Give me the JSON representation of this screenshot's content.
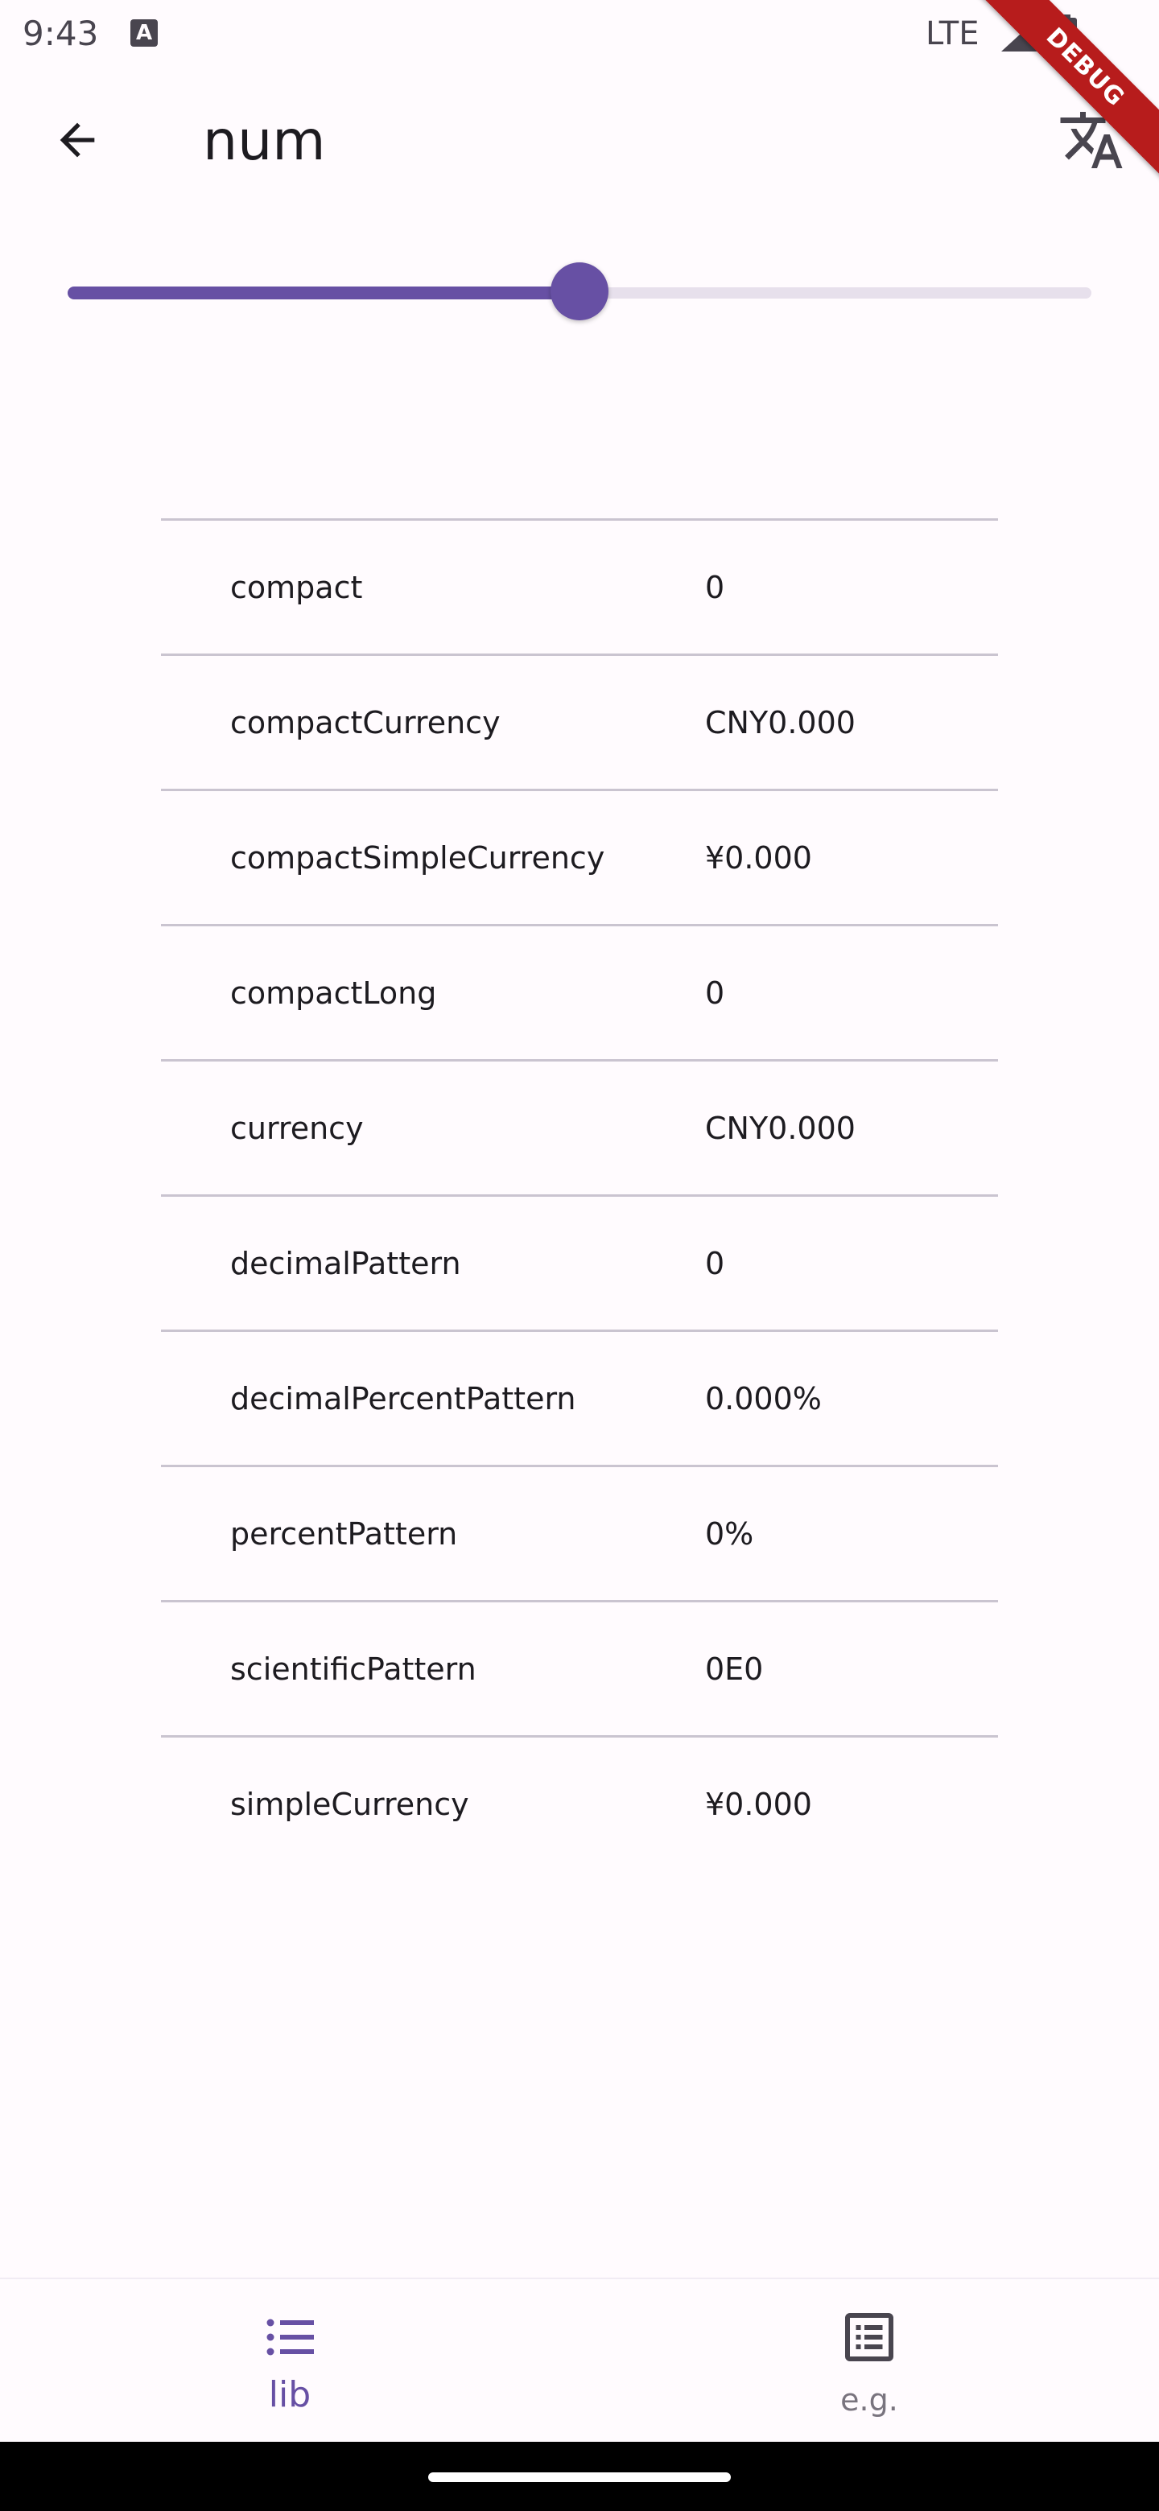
{
  "status_bar": {
    "time": "9:43",
    "network": "LTE",
    "icons": [
      "keyboard-a-icon",
      "signal-icon",
      "battery-icon"
    ]
  },
  "debug_banner": {
    "label": "DEBUG"
  },
  "app_bar": {
    "title": "num",
    "back_icon": "arrow-back-icon",
    "translate_icon": "translate-icon"
  },
  "slider": {
    "value_fraction": 0.5
  },
  "format_table": {
    "rows": [
      {
        "name": "compact",
        "value": "0"
      },
      {
        "name": "compactCurrency",
        "value": "CNY0.000"
      },
      {
        "name": "compactSimpleCurrency",
        "value": "¥0.000"
      },
      {
        "name": "compactLong",
        "value": "0"
      },
      {
        "name": "currency",
        "value": "CNY0.000"
      },
      {
        "name": "decimalPattern",
        "value": "0"
      },
      {
        "name": "decimalPercentPattern",
        "value": "0.000%"
      },
      {
        "name": "percentPattern",
        "value": "0%"
      },
      {
        "name": "scientificPattern",
        "value": "0E0"
      },
      {
        "name": "simpleCurrency",
        "value": "¥0.000"
      }
    ]
  },
  "bottom_nav": {
    "items": [
      {
        "label": "lib",
        "icon": "list-icon",
        "active": true
      },
      {
        "label": "e.g.",
        "icon": "article-icon",
        "active": false
      }
    ]
  },
  "colors": {
    "primary": "#6750a4",
    "background": "#fffbfe",
    "divider": "#cac4d0",
    "debug_banner": "#b71c1c"
  }
}
